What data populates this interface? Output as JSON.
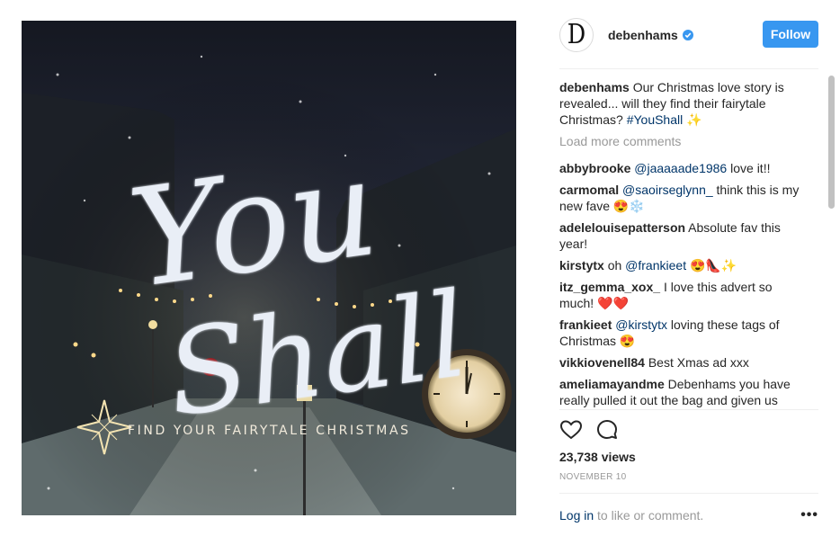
{
  "post": {
    "image_title": "You Shall",
    "image_tagline": "FIND YOUR FAIRYTALE CHRISTMAS"
  },
  "header": {
    "avatar_letter": "D",
    "username": "debenhams",
    "follow_label": "Follow"
  },
  "caption": {
    "user": "debenhams",
    "text": "Our Christmas love story is revealed... will they find their fairytale Christmas?",
    "hashtag": "#YouShall",
    "emoji": "✨"
  },
  "load_more": "Load more comments",
  "comments": [
    {
      "user": "abbybrooke",
      "mention": "@jaaaaade1986",
      "text": "love it!!"
    },
    {
      "user": "carmomal",
      "mention": "@saoirseglynn_",
      "text": "think this is my new fave 😍❄️"
    },
    {
      "user": "adelelouisepatterson",
      "mention": "",
      "text": "Absolute fav this year!"
    },
    {
      "user": "kirstytx",
      "pre": "oh",
      "mention": "@frankieet",
      "text": "😍👠✨"
    },
    {
      "user": "itz_gemma_xox_",
      "mention": "",
      "text": "I love this advert so much! ❤️❤️"
    },
    {
      "user": "frankieet",
      "mention": "@kirstytx",
      "text": "loving these tags of Christmas 😍"
    },
    {
      "user": "vikkiovenell84",
      "mention": "",
      "text": "Best Xmas ad xxx"
    },
    {
      "user": "ameliamayandme",
      "mention": "",
      "text": "Debenhams you have really pulled it out the bag and given us"
    }
  ],
  "stats": {
    "views": "23,738 views",
    "date": "NOVEMBER 10"
  },
  "footer": {
    "login": "Log in",
    "rest": " to like or comment.",
    "more": "•••"
  },
  "colors": {
    "accent": "#3897f0",
    "link": "#003569",
    "muted": "#999999"
  }
}
